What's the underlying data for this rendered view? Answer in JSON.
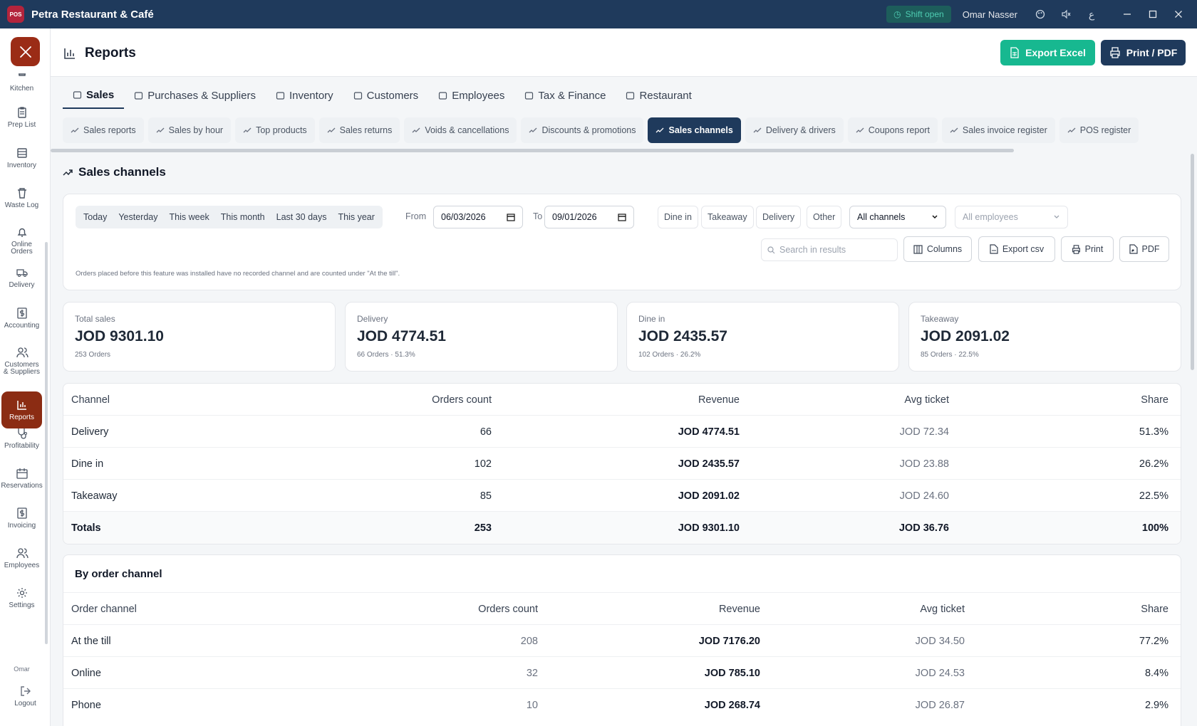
{
  "titlebar": {
    "app_title": "Petra Restaurant & Café",
    "logo_text": "POS",
    "shift": "Shift open",
    "user": "Omar Nasser"
  },
  "sidebar": {
    "items": [
      {
        "label": "Kitchen",
        "icon": "kitchen-icon"
      },
      {
        "label": "Prep List",
        "icon": "clipboard-icon"
      },
      {
        "label": "Inventory",
        "icon": "inventory-icon"
      },
      {
        "label": "Waste Log",
        "icon": "trash-icon"
      },
      {
        "label": "Online\nOrders",
        "icon": "bell-icon"
      },
      {
        "label": "Delivery",
        "icon": "truck-icon"
      },
      {
        "label": "Accounting",
        "icon": "dollar-icon"
      },
      {
        "label": "Customers\n& Suppliers",
        "icon": "users-icon"
      },
      {
        "label": "Reports",
        "icon": "bar-chart-icon",
        "active": true
      },
      {
        "label": "Profitability",
        "icon": "stethoscope-icon"
      },
      {
        "label": "Reservations",
        "icon": "calendar-icon"
      },
      {
        "label": "Invoicing",
        "icon": "dollar-icon"
      },
      {
        "label": "Employees",
        "icon": "users-icon"
      },
      {
        "label": "Settings",
        "icon": "gear-icon"
      }
    ],
    "user_short": "Omar",
    "logout": "Logout"
  },
  "header": {
    "title": "Reports",
    "export_excel": "Export Excel",
    "print_pdf": "Print / PDF"
  },
  "main_tabs": [
    "Sales",
    "Purchases & Suppliers",
    "Inventory",
    "Customers",
    "Employees",
    "Tax & Finance",
    "Restaurant"
  ],
  "sub_tabs": [
    "Sales reports",
    "Sales by hour",
    "Top products",
    "Sales returns",
    "Voids & cancellations",
    "Discounts & promotions",
    "Sales channels",
    "Delivery & drivers",
    "Coupons report",
    "Sales invoice register",
    "POS register"
  ],
  "section_title": "Sales channels",
  "filters": {
    "quick": [
      "Today",
      "Yesterday",
      "This week",
      "This month",
      "Last 30 days",
      "This year"
    ],
    "from_label": "From",
    "from_value": "06/03/2026",
    "to_label": "To",
    "to_value": "09/01/2026",
    "channels": [
      "Dine in",
      "Takeaway",
      "Delivery",
      "Other"
    ],
    "channel_select": "All channels",
    "employee_select": "All employees",
    "search_placeholder": "Search in results",
    "columns": "Columns",
    "export_csv": "Export csv",
    "print": "Print",
    "pdf": "PDF",
    "note": "Orders placed before this feature was installed have no recorded channel and are counted under \"At the till\"."
  },
  "cards": [
    {
      "label": "Total sales",
      "value": "JOD 9301.10",
      "sub": "253 Orders"
    },
    {
      "label": "Delivery",
      "value": "JOD 4774.51",
      "sub": "66 Orders · 51.3%"
    },
    {
      "label": "Dine in",
      "value": "JOD 2435.57",
      "sub": "102 Orders · 26.2%"
    },
    {
      "label": "Takeaway",
      "value": "JOD 2091.02",
      "sub": "85 Orders · 22.5%"
    }
  ],
  "table1": {
    "headers": [
      "Channel",
      "Orders count",
      "Revenue",
      "Avg ticket",
      "Share"
    ],
    "rows": [
      [
        "Delivery",
        "66",
        "JOD 4774.51",
        "JOD 72.34",
        "51.3%"
      ],
      [
        "Dine in",
        "102",
        "JOD 2435.57",
        "JOD 23.88",
        "26.2%"
      ],
      [
        "Takeaway",
        "85",
        "JOD 2091.02",
        "JOD 24.60",
        "22.5%"
      ]
    ],
    "totals": [
      "Totals",
      "253",
      "JOD 9301.10",
      "JOD 36.76",
      "100%"
    ]
  },
  "table2": {
    "title": "By order channel",
    "headers": [
      "Order channel",
      "Orders count",
      "Revenue",
      "Avg ticket",
      "Share"
    ],
    "rows": [
      [
        "At the till",
        "208",
        "JOD 7176.20",
        "JOD 34.50",
        "77.2%"
      ],
      [
        "Online",
        "32",
        "JOD 785.10",
        "JOD 24.53",
        "8.4%"
      ],
      [
        "Phone",
        "10",
        "JOD 268.74",
        "JOD 26.87",
        "2.9%"
      ]
    ]
  }
}
